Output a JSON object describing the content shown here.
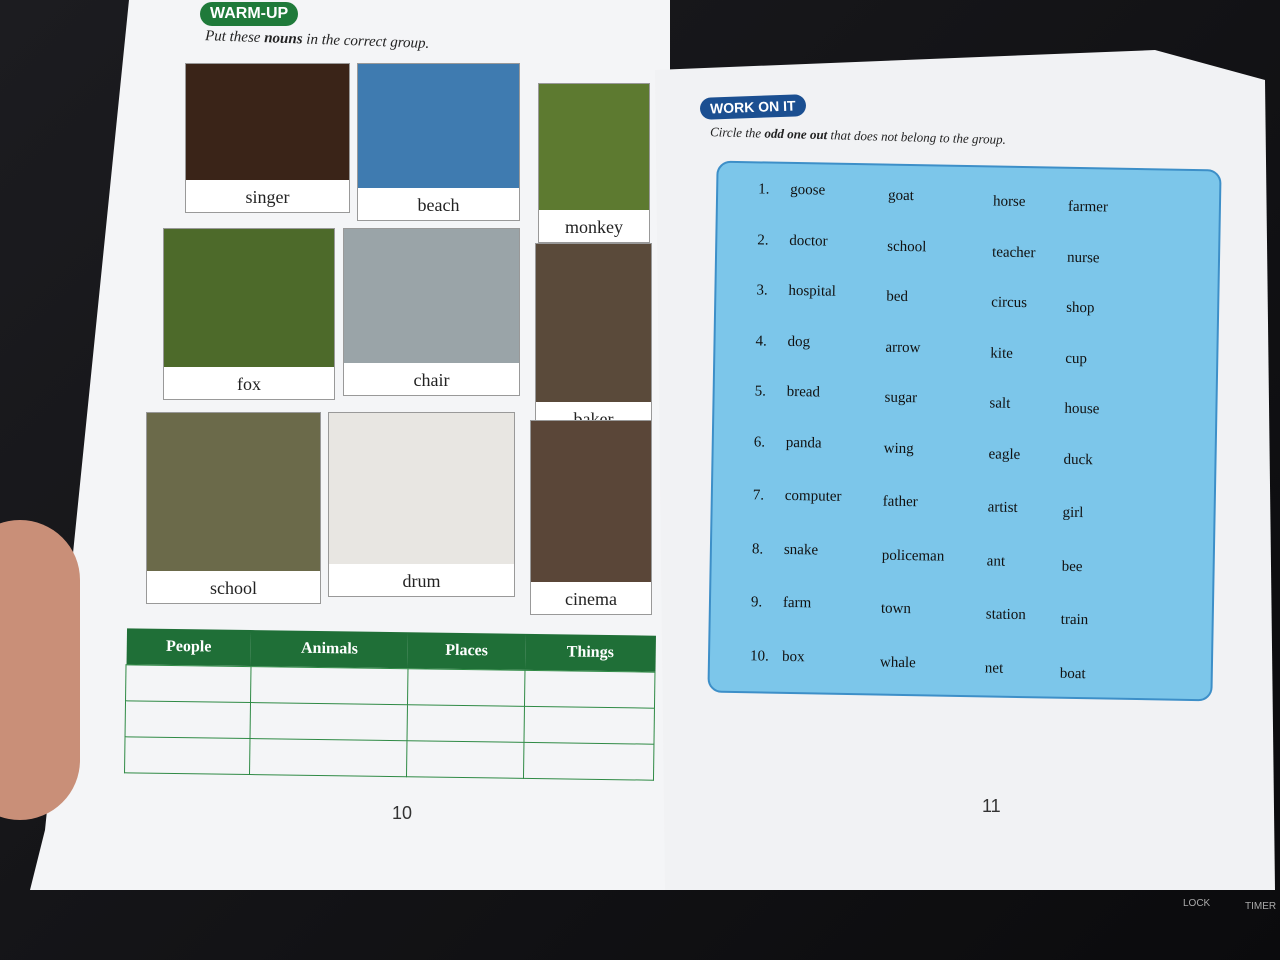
{
  "left_page": {
    "badge": "WARM-UP",
    "instruction_pre": "Put these ",
    "instruction_bold": "nouns",
    "instruction_post": " in the correct group.",
    "pictures": [
      {
        "label": "singer",
        "color": "#3a2418"
      },
      {
        "label": "beach",
        "color": "#3f7bb0"
      },
      {
        "label": "monkey",
        "color": "#5d7a30"
      },
      {
        "label": "fox",
        "color": "#4d6a2a"
      },
      {
        "label": "chair",
        "color": "#9aa4a8"
      },
      {
        "label": "baker",
        "color": "#5a4a3a"
      },
      {
        "label": "school",
        "color": "#6b6a4a"
      },
      {
        "label": "drum",
        "color": "#e8e6e2"
      },
      {
        "label": "cinema",
        "color": "#5a4638"
      }
    ],
    "table_headers": [
      "People",
      "Animals",
      "Places",
      "Things"
    ],
    "page_number": "10"
  },
  "right_page": {
    "badge": "WORK ON IT",
    "instruction_pre": "Circle the ",
    "instruction_bold": "odd one out",
    "instruction_post": " that does not belong to the group.",
    "rows": [
      {
        "num": "1.",
        "words": [
          "goose",
          "goat",
          "horse",
          "farmer"
        ]
      },
      {
        "num": "2.",
        "words": [
          "doctor",
          "school",
          "teacher",
          "nurse"
        ]
      },
      {
        "num": "3.",
        "words": [
          "hospital",
          "bed",
          "circus",
          "shop"
        ]
      },
      {
        "num": "4.",
        "words": [
          "dog",
          "arrow",
          "kite",
          "cup"
        ]
      },
      {
        "num": "5.",
        "words": [
          "bread",
          "sugar",
          "salt",
          "house"
        ]
      },
      {
        "num": "6.",
        "words": [
          "panda",
          "wing",
          "eagle",
          "duck"
        ]
      },
      {
        "num": "7.",
        "words": [
          "computer",
          "father",
          "artist",
          "girl"
        ]
      },
      {
        "num": "8.",
        "words": [
          "snake",
          "policeman",
          "ant",
          "bee"
        ]
      },
      {
        "num": "9.",
        "words": [
          "farm",
          "town",
          "station",
          "train"
        ]
      },
      {
        "num": "10.",
        "words": [
          "box",
          "whale",
          "net",
          "boat"
        ]
      }
    ],
    "page_number": "11"
  },
  "cooktop": {
    "lock": "LOCK",
    "timer": "TIMER"
  },
  "colors": {
    "green": "#1f7a3a",
    "blue_badge": "#1b4f91",
    "box_blue": "#7cc6ea"
  }
}
